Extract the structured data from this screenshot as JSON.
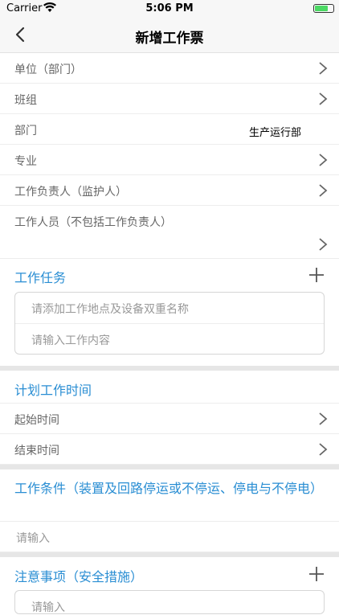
{
  "status_bar": {
    "carrier": "Carrier",
    "time": "5:06 PM"
  },
  "nav": {
    "title": "新增工作票"
  },
  "rows": [
    {
      "label": "单位（部门）",
      "value": ""
    },
    {
      "label": "班组",
      "value": ""
    },
    {
      "label": "部门",
      "value": "生产运行部"
    },
    {
      "label": "专业",
      "value": ""
    },
    {
      "label": "工作负责人（监护人）",
      "value": ""
    },
    {
      "label": "工作人员（不包括工作负责人）",
      "value": ""
    }
  ],
  "task_section": {
    "title": "工作任务",
    "location_placeholder": "请添加工作地点及设备双重名称",
    "content_placeholder": "请输入工作内容"
  },
  "time_section": {
    "title": "计划工作时间",
    "start_label": "起始时间",
    "end_label": "结束时间"
  },
  "condition_section": {
    "title": "工作条件（装置及回路停运或不停运、停电与不停电）",
    "placeholder": "请输入"
  },
  "notice_section": {
    "title": "注意事项（安全措施）",
    "placeholder": "请输入"
  },
  "colors": {
    "accent": "#2a8ed3",
    "battery": "#4cd964"
  }
}
